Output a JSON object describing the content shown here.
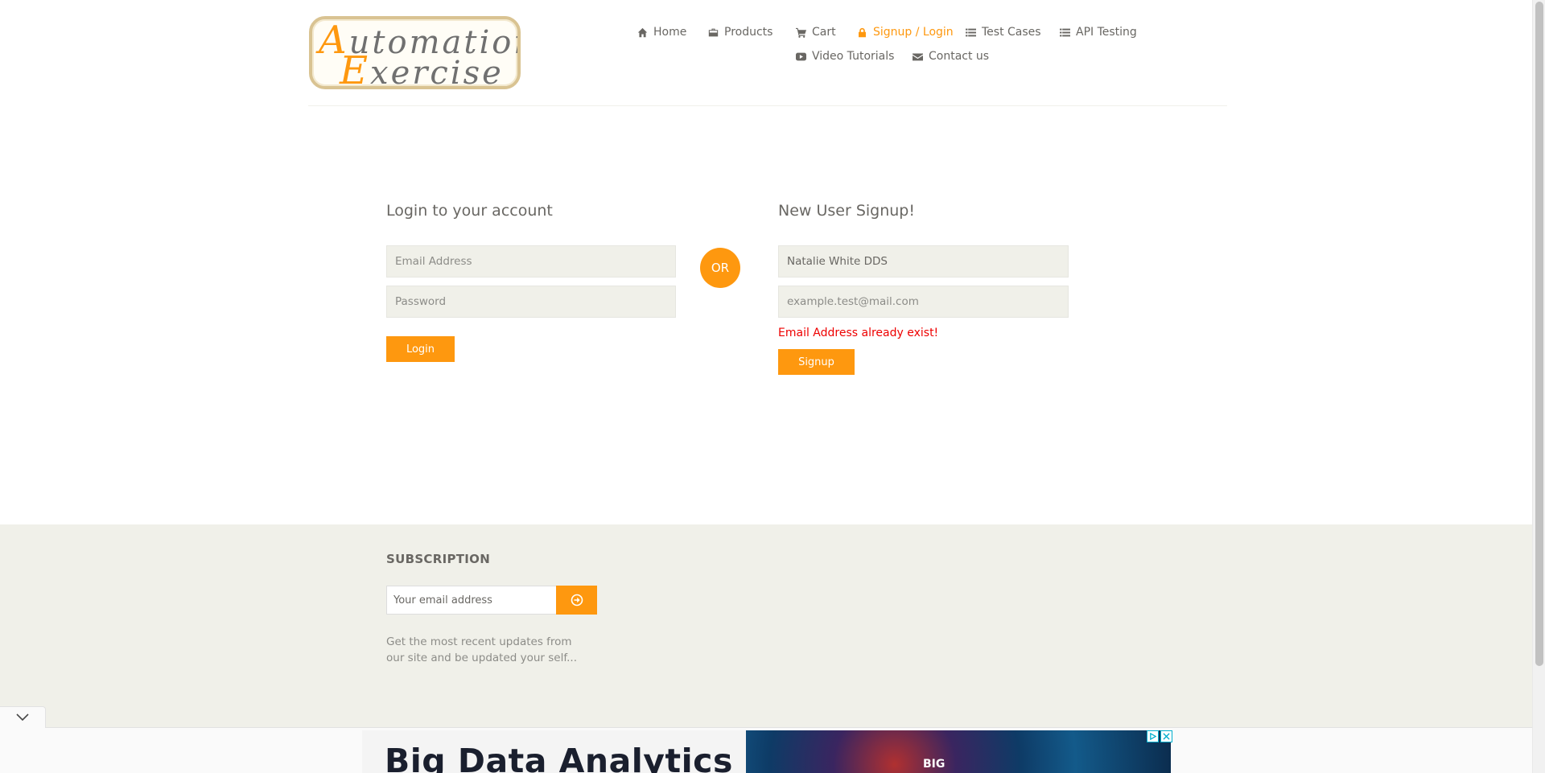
{
  "logo": {
    "line1_cap": "A",
    "line1_rest": "utomation",
    "line2_cap": "E",
    "line2_rest": "xercise"
  },
  "nav": {
    "items": [
      {
        "label": "Home",
        "icon": "home-icon"
      },
      {
        "label": "Products",
        "icon": "briefcase-icon"
      },
      {
        "label": "Cart",
        "icon": "cart-icon"
      },
      {
        "label": "Signup / Login",
        "icon": "lock-icon",
        "active": true
      },
      {
        "label": "Test Cases",
        "icon": "list-icon"
      },
      {
        "label": "API Testing",
        "icon": "list-icon"
      },
      {
        "label": "Video Tutorials",
        "icon": "youtube-icon"
      },
      {
        "label": "Contact us",
        "icon": "envelope-icon"
      }
    ]
  },
  "login": {
    "title": "Login to your account",
    "email_placeholder": "Email Address",
    "password_placeholder": "Password",
    "button": "Login"
  },
  "or_label": "OR",
  "signup": {
    "title": "New User Signup!",
    "name_value": "Natalie White DDS",
    "email_placeholder": "example.test@mail.com",
    "error": "Email Address already exist!",
    "button": "Signup"
  },
  "subscription": {
    "title": "SUBSCRIPTION",
    "placeholder": "Your email address",
    "description": "Get the most recent updates from our site and be updated your self..."
  },
  "ad": {
    "headline": "Big Data Analytics",
    "image_text": "BIG"
  },
  "colors": {
    "accent": "#fe980f",
    "error": "#ee0000",
    "field_bg": "#f0f0e9",
    "text": "#696763"
  }
}
